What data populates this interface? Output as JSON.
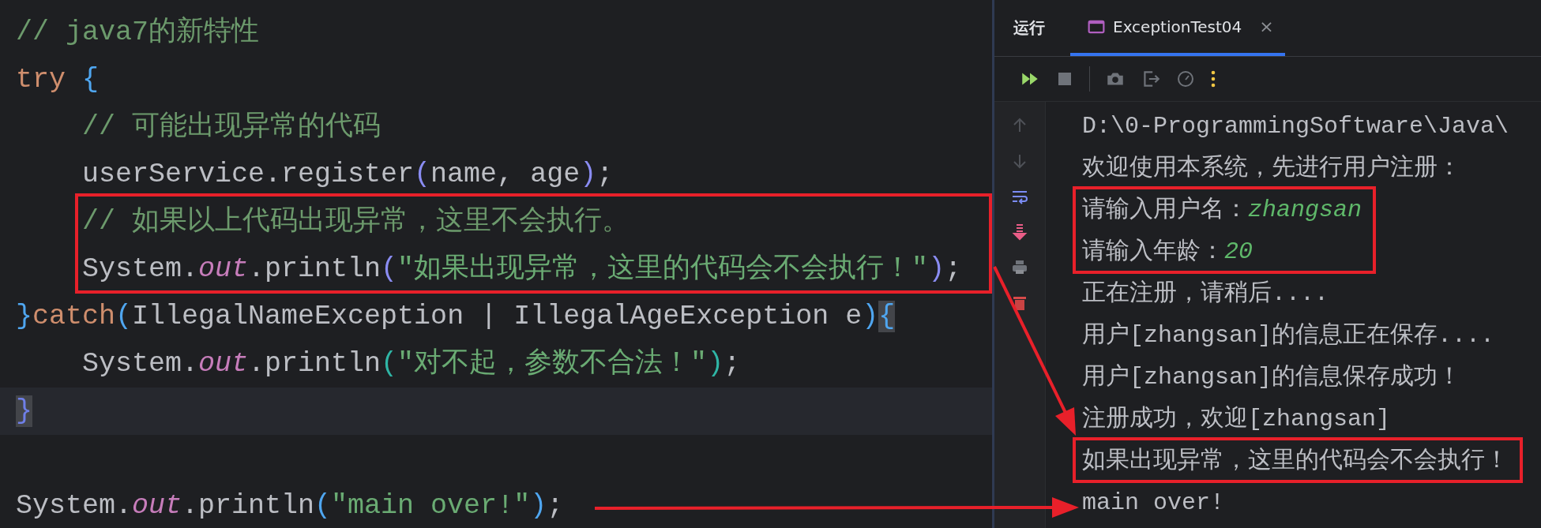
{
  "editor": {
    "lines": [
      {
        "tokens": [
          {
            "text": "// java7的新特性",
            "kind": "comment"
          }
        ]
      },
      {
        "tokens": [
          {
            "text": "try",
            "kind": "keyword"
          },
          {
            "text": " {",
            "kind": "bracket",
            "color": "#4fa6f0"
          }
        ]
      },
      {
        "tokens": [
          {
            "text": "    // 可能出现异常的代码",
            "kind": "comment"
          }
        ]
      },
      {
        "tokens": [
          {
            "text": "    userService.register",
            "kind": "plain"
          },
          {
            "text": "(",
            "kind": "bracket",
            "color": "#8a8cf2"
          },
          {
            "text": "name, age",
            "kind": "plain"
          },
          {
            "text": ")",
            "kind": "bracket",
            "color": "#8a8cf2"
          },
          {
            "text": ";",
            "kind": "plain"
          }
        ]
      },
      {
        "tokens": [
          {
            "text": "    // 如果以上代码出现异常，这里不会执行。",
            "kind": "comment"
          }
        ]
      },
      {
        "tokens": [
          {
            "text": "    System.",
            "kind": "plain"
          },
          {
            "text": "out",
            "kind": "field"
          },
          {
            "text": ".println",
            "kind": "plain"
          },
          {
            "text": "(",
            "kind": "bracket",
            "color": "#8a8cf2"
          },
          {
            "text": "\"如果出现异常，这里的代码会不会执行！\"",
            "kind": "string"
          },
          {
            "text": ")",
            "kind": "bracket",
            "color": "#8a8cf2"
          },
          {
            "text": ";",
            "kind": "plain"
          }
        ]
      },
      {
        "tokens": [
          {
            "text": "}",
            "kind": "bracket",
            "color": "#4fa6f0"
          },
          {
            "text": "catch",
            "kind": "keyword"
          },
          {
            "text": "(",
            "kind": "bracket",
            "color": "#4fa6f0"
          },
          {
            "text": "IllegalNameException | IllegalAgeException e",
            "kind": "plain"
          },
          {
            "text": ")",
            "kind": "bracket",
            "color": "#4fa6f0"
          },
          {
            "text": "{",
            "kind": "bracket",
            "matched": true
          }
        ]
      },
      {
        "tokens": [
          {
            "text": "    System.",
            "kind": "plain"
          },
          {
            "text": "out",
            "kind": "field"
          },
          {
            "text": ".println",
            "kind": "plain"
          },
          {
            "text": "(",
            "kind": "bracket",
            "color": "#2fb5a5"
          },
          {
            "text": "\"对不起，参数不合法！\"",
            "kind": "string"
          },
          {
            "text": ")",
            "kind": "bracket",
            "color": "#2fb5a5"
          },
          {
            "text": ";",
            "kind": "plain"
          }
        ]
      },
      {
        "current": true,
        "tokens": [
          {
            "text": "}",
            "kind": "bracket",
            "color": "#6f7fe8",
            "matched": true
          }
        ]
      },
      {
        "blank": true
      },
      {
        "tokens": [
          {
            "text": "System.",
            "kind": "plain"
          },
          {
            "text": "out",
            "kind": "field"
          },
          {
            "text": ".println",
            "kind": "plain"
          },
          {
            "text": "(",
            "kind": "bracket",
            "color": "#4fa6f0"
          },
          {
            "text": "\"main over!\"",
            "kind": "string"
          },
          {
            "text": ")",
            "kind": "bracket",
            "color": "#4fa6f0"
          },
          {
            "text": ";",
            "kind": "plain"
          }
        ]
      }
    ]
  },
  "run_panel": {
    "title": "运行",
    "tabs": [
      {
        "label": "ExceptionTest04",
        "selected": true,
        "closable": true,
        "close": "×"
      }
    ],
    "console": {
      "lines": [
        {
          "segments": [
            {
              "text": "D:\\0-ProgrammingSoftware\\Java\\",
              "kind": "output"
            }
          ]
        },
        {
          "segments": [
            {
              "text": "欢迎使用本系统，先进行用户注册：",
              "kind": "output"
            }
          ]
        },
        {
          "boxed": true,
          "segments": [
            {
              "text": "请输入用户名：",
              "kind": "output"
            },
            {
              "text": "zhangsan",
              "kind": "input"
            }
          ]
        },
        {
          "boxed": true,
          "segments": [
            {
              "text": "请输入年龄：",
              "kind": "output"
            },
            {
              "text": "20",
              "kind": "input"
            }
          ]
        },
        {
          "segments": [
            {
              "text": "正在注册，请稍后....",
              "kind": "output"
            }
          ]
        },
        {
          "segments": [
            {
              "text": "用户[zhangsan]的信息正在保存....",
              "kind": "output"
            }
          ]
        },
        {
          "segments": [
            {
              "text": "用户[zhangsan]的信息保存成功！",
              "kind": "output"
            }
          ]
        },
        {
          "segments": [
            {
              "text": "注册成功，欢迎[zhangsan]",
              "kind": "output"
            }
          ]
        },
        {
          "boxed": true,
          "segments": [
            {
              "text": "如果出现异常，这里的代码会不会执行！",
              "kind": "output"
            }
          ]
        },
        {
          "segments": [
            {
              "text": "main over!",
              "kind": "output"
            }
          ]
        }
      ]
    }
  }
}
